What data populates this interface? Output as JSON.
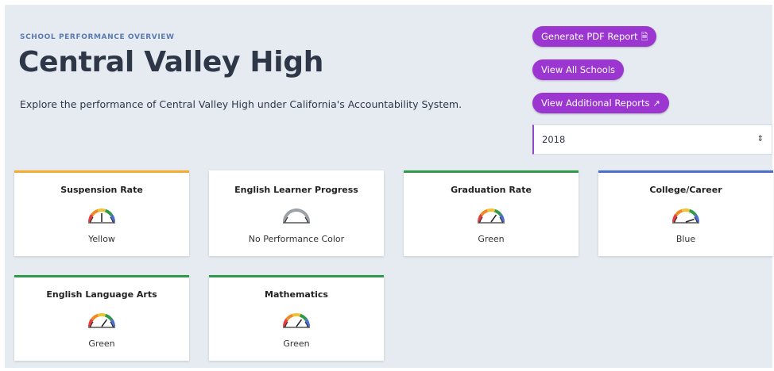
{
  "header": {
    "eyebrow": "SCHOOL PERFORMANCE OVERVIEW",
    "title": "Central Valley High",
    "subtitle": "Explore the performance of Central Valley High under California's Accountability System."
  },
  "actions": {
    "pdf_label": "Generate PDF Report",
    "pdf_icon": "pdf-file-icon",
    "all_schools_label": "View All Schools",
    "additional_label": "View Additional Reports",
    "additional_icon": "external-link-icon",
    "button_color": "#9b37d0"
  },
  "year_select": {
    "value": "2018"
  },
  "indicators": [
    {
      "label": "Suspension Rate",
      "status": "Yellow",
      "accent": "#f6ad2f",
      "level": 3
    },
    {
      "label": "English Learner Progress",
      "status": "No Performance Color",
      "accent": "",
      "level": 0
    },
    {
      "label": "Graduation Rate",
      "status": "Green",
      "accent": "#2f9a4a",
      "level": 4
    },
    {
      "label": "College/Career",
      "status": "Blue",
      "accent": "#4a6fcf",
      "level": 5
    },
    {
      "label": "English Language Arts",
      "status": "Green",
      "accent": "#2f9a4a",
      "level": 4
    },
    {
      "label": "Mathematics",
      "status": "Green",
      "accent": "#2f9a4a",
      "level": 4
    }
  ],
  "gauge_colors": [
    "#e53e3e",
    "#f08a24",
    "#f2c230",
    "#2f9a4a",
    "#4a6fcf"
  ]
}
